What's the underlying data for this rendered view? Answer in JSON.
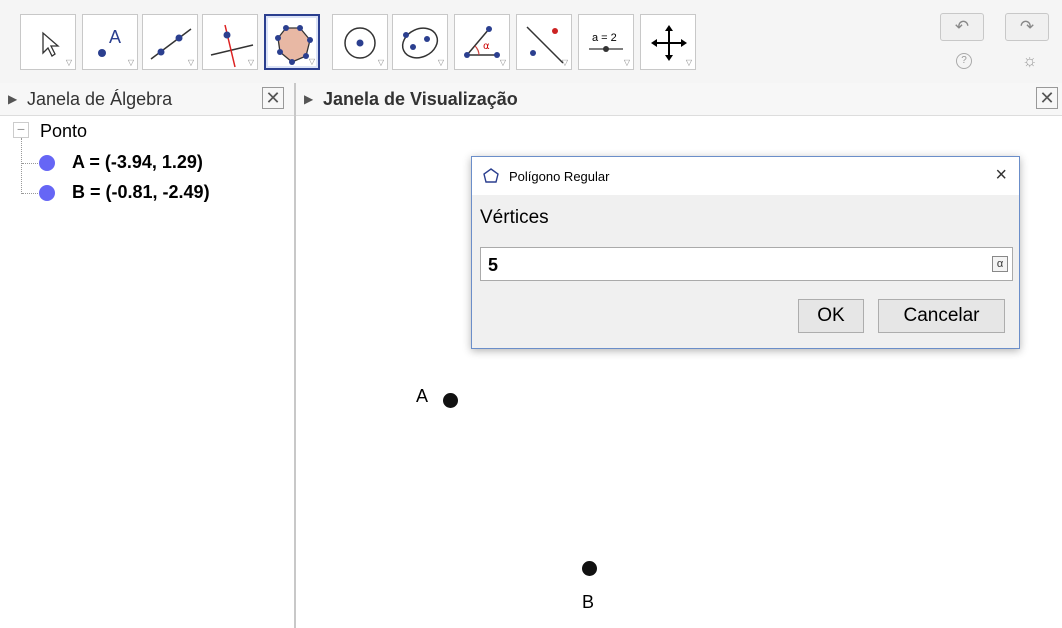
{
  "toolbar": {
    "tools": [
      {
        "name": "move-tool",
        "icon": "cursor-arrow"
      },
      {
        "name": "point-tool",
        "icon": "point-A",
        "glyph": "A"
      },
      {
        "name": "line-tool",
        "icon": "line-through-points"
      },
      {
        "name": "perpendicular-tool",
        "icon": "perpendicular-line"
      },
      {
        "name": "polygon-tool",
        "icon": "regular-polygon",
        "selected": true
      },
      {
        "name": "circle-tool",
        "icon": "circle-center-point"
      },
      {
        "name": "conic-tool",
        "icon": "ellipse"
      },
      {
        "name": "angle-tool",
        "icon": "angle-alpha",
        "glyph": "α"
      },
      {
        "name": "reflect-tool",
        "icon": "reflect-about-line"
      },
      {
        "name": "slider-tool",
        "icon": "slider",
        "glyph": "a = 2"
      },
      {
        "name": "move-view-tool",
        "icon": "four-way-arrows"
      }
    ],
    "undo_icon": "↶",
    "redo_icon": "↷",
    "help_icon": "?",
    "settings_icon": "☼"
  },
  "algebra": {
    "title": "Janela de Álgebra",
    "group": "Ponto",
    "items": [
      {
        "text": "A = (-3.94, 1.29)",
        "color": "#6666f5"
      },
      {
        "text": "B = (-0.81, -2.49)",
        "color": "#6666f5"
      }
    ]
  },
  "graphics": {
    "title": "Janela de Visualização",
    "points": [
      {
        "label": "A",
        "x": -3.94,
        "y": 1.29
      },
      {
        "label": "B",
        "x": -0.81,
        "y": -2.49
      }
    ]
  },
  "dialog": {
    "title": "Polígono Regular",
    "label": "Vértices",
    "input_value": "5",
    "alpha_button": "α",
    "ok_label": "OK",
    "cancel_label": "Cancelar",
    "close_icon": "×"
  },
  "colors": {
    "accent": "#2b3f8f",
    "point_fill": "#6666f5",
    "dialog_border": "#6b8ec9"
  }
}
